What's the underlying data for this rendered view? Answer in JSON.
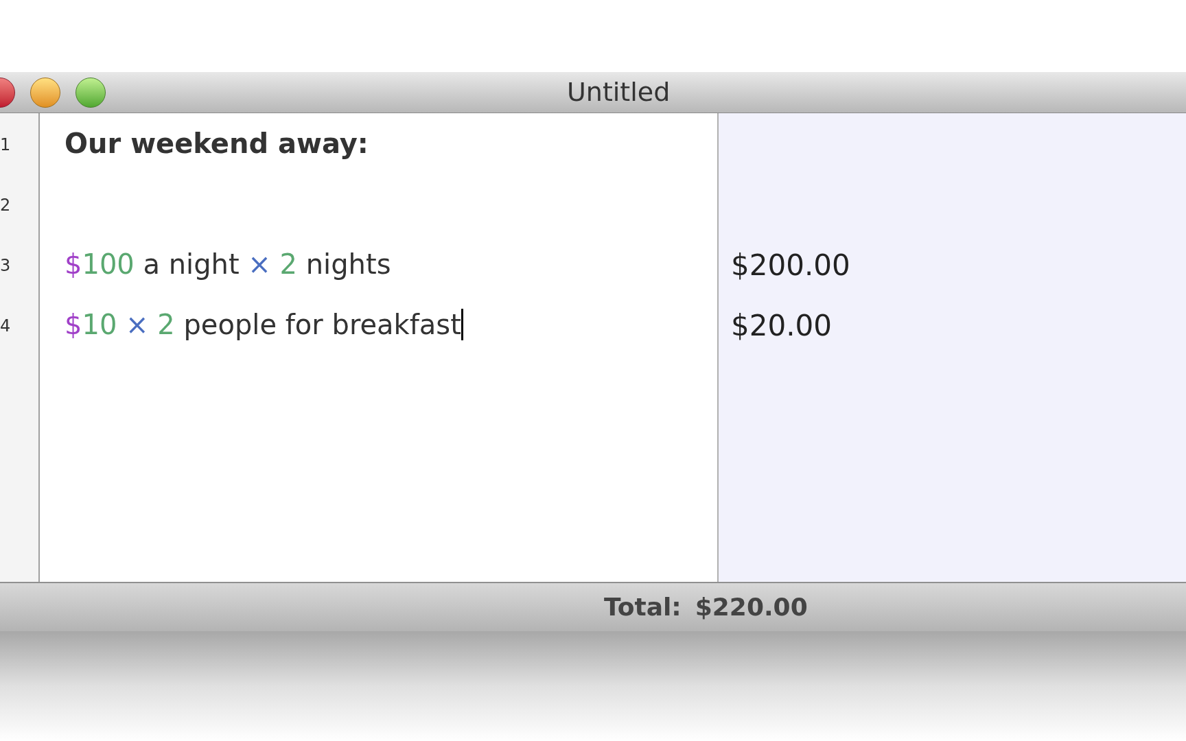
{
  "window": {
    "title": "Untitled"
  },
  "lines": [
    {
      "number": "1",
      "bold": true,
      "cursor": false,
      "tokens": [
        {
          "kind": "text",
          "text": "Our weekend away:"
        }
      ]
    },
    {
      "number": "2"
    },
    {
      "number": "3",
      "bold": false,
      "cursor": false,
      "tokens": [
        {
          "kind": "currency",
          "text": "$"
        },
        {
          "kind": "number",
          "text": "100"
        },
        {
          "kind": "text",
          "text": " a night "
        },
        {
          "kind": "operator",
          "text": "×"
        },
        {
          "kind": "number",
          "text": " 2"
        },
        {
          "kind": "text",
          "text": " nights"
        }
      ],
      "result": "$200.00"
    },
    {
      "number": "4",
      "bold": false,
      "cursor": true,
      "tokens": [
        {
          "kind": "currency",
          "text": "$"
        },
        {
          "kind": "number",
          "text": "10"
        },
        {
          "kind": "operator",
          "text": " × "
        },
        {
          "kind": "number",
          "text": "2"
        },
        {
          "kind": "text",
          "text": " people for breakfast"
        }
      ],
      "result": "$20.00"
    }
  ],
  "footer": {
    "label": "Total:",
    "value": "$220.00"
  }
}
